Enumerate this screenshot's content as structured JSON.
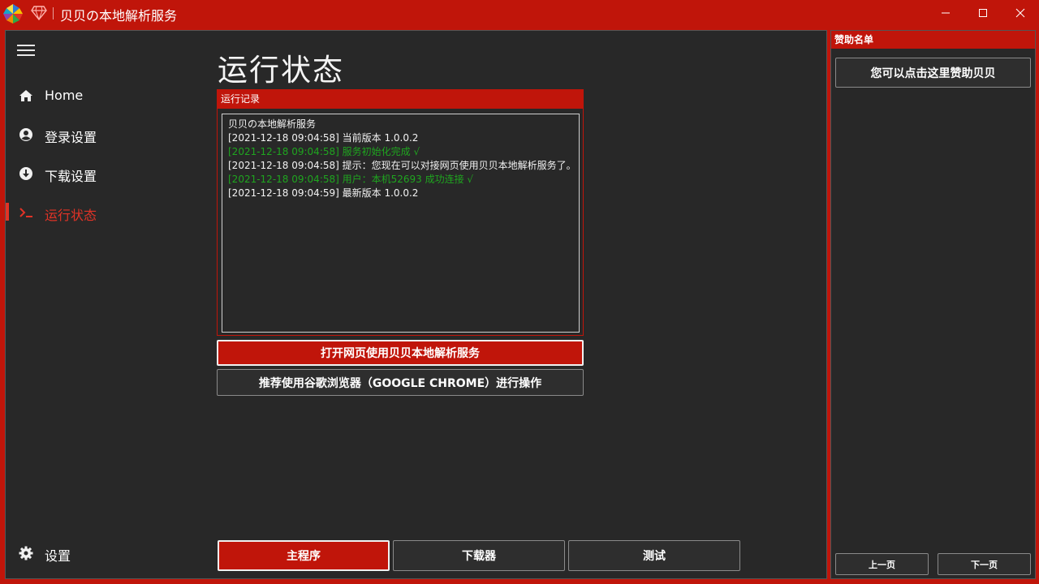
{
  "window": {
    "title": "贝贝の本地解析服务"
  },
  "sidebar": {
    "items": [
      {
        "label": "Home",
        "icon": "home-icon"
      },
      {
        "label": "登录设置",
        "icon": "user-circle-icon"
      },
      {
        "label": "下载设置",
        "icon": "download-circle-icon"
      },
      {
        "label": "运行状态",
        "icon": "terminal-icon",
        "active": true
      }
    ],
    "settings_label": "设置"
  },
  "main": {
    "page_title": "运行状态",
    "log_header": "运行记录",
    "log_lines": [
      {
        "text": "贝贝の本地解析服务",
        "status": "normal"
      },
      {
        "text": "[2021-12-18 09:04:58] 当前版本 1.0.0.2",
        "status": "normal"
      },
      {
        "text": "[2021-12-18 09:04:58] 服务初始化完成 √",
        "status": "ok"
      },
      {
        "text": "[2021-12-18 09:04:58] 提示：您现在可以对接网页使用贝贝本地解析服务了。",
        "status": "normal"
      },
      {
        "text": "[2021-12-18 09:04:58] 用户：本机52693 成功连接 √",
        "status": "ok"
      },
      {
        "text": "[2021-12-18 09:04:59] 最新版本 1.0.0.2",
        "status": "normal"
      }
    ],
    "open_web_label": "打开网页使用贝贝本地解析服务",
    "recommend_label": "推荐使用谷歌浏览器（GOOGLE CHROME）进行操作",
    "bottom_tabs": [
      "主程序",
      "下载器",
      "测试"
    ]
  },
  "sponsor": {
    "header": "赞助名单",
    "sponsor_button": "您可以点击这里赞助贝贝",
    "prev_label": "上一页",
    "next_label": "下一页"
  },
  "colors": {
    "accent": "#c0150a",
    "active_text": "#e23326",
    "ok_text": "#1fa51f",
    "panel_bg": "#282828"
  }
}
